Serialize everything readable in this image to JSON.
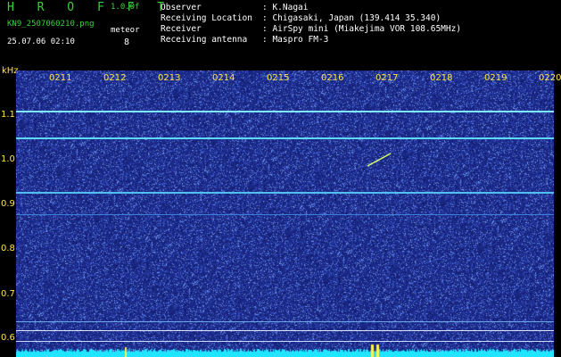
{
  "header": {
    "app_title": "HROFFT",
    "app_version": "1.0.0f",
    "file_name": "KN9_2507060210.png",
    "timestamp": "25.07.06 02:10",
    "meteor_label": "meteor",
    "meteor_count": "8"
  },
  "info": {
    "observer_key": "Observer",
    "observer_val": ": K.Nagai",
    "location_key": "Receiving Location",
    "location_val": ": Chigasaki, Japan (139.414 35.340)",
    "receiver_key": "Receiver",
    "receiver_val": ": AirSpy mini (Miakejima VOR 108.65MHz)",
    "antenna_key": "Receiving antenna",
    "antenna_val": ": Maspro FM-3"
  },
  "spectrogram": {
    "y_unit": "kHz",
    "y_ticks": [
      "1.1",
      "1.0",
      "0.9",
      "0.8",
      "0.7",
      "0.6"
    ],
    "x_ticks": [
      "0211",
      "0212",
      "0213",
      "0214",
      "0215",
      "0216",
      "0217",
      "0218",
      "0219",
      "0220"
    ],
    "colors": {
      "background": "#1d2c8f",
      "text": "#ffe640",
      "signal": "#4fe0ff",
      "floor": "#20e5ff"
    }
  }
}
